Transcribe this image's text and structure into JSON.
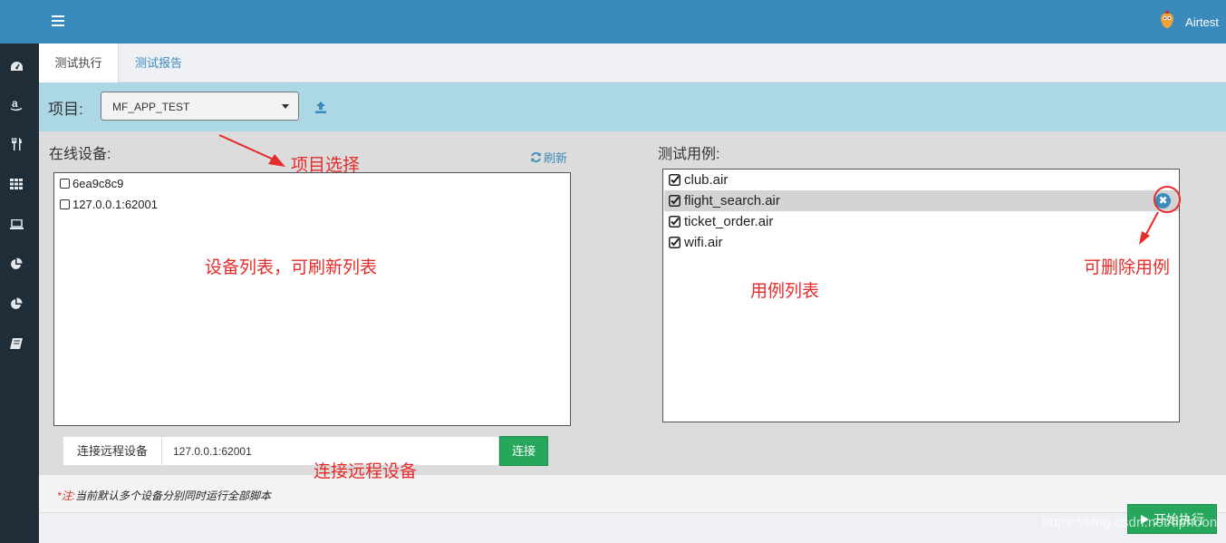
{
  "header": {
    "brand": "Airtest"
  },
  "sidebar": {
    "icons": [
      "dashboard-icon",
      "amazon-icon",
      "cutlery-icon",
      "grid-icon",
      "laptop-icon",
      "pie-chart-icon",
      "pie-chart-icon",
      "book-icon"
    ]
  },
  "tabs": [
    {
      "label": "测试执行"
    },
    {
      "label": "测试报告"
    }
  ],
  "project": {
    "label": "项目:",
    "selected": "MF_APP_TEST"
  },
  "devices": {
    "title": "在线设备:",
    "refresh_label": "刷新",
    "items": [
      {
        "name": "6ea9c8c9"
      },
      {
        "name": "127.0.0.1:62001"
      }
    ]
  },
  "cases": {
    "title": "测试用例:",
    "items": [
      {
        "name": "club.air"
      },
      {
        "name": "flight_search.air"
      },
      {
        "name": "ticket_order.air"
      },
      {
        "name": "wifi.air"
      }
    ]
  },
  "remote": {
    "addon": "连接远程设备",
    "value": "127.0.0.1:62001",
    "connect_label": "连接"
  },
  "footer": {
    "note_star": "*注:",
    "note_text": "当前默认多个设备分别同时运行全部脚本",
    "start_label": "开始执行"
  },
  "annotations": {
    "project_select": "项目选择",
    "device_list": "设备列表，可刷新列表",
    "case_list": "用例列表",
    "delete_case": "可删除用例",
    "remote_device": "连接远程设备"
  },
  "watermark": "https://blog.csdn.net/tiphoon",
  "colors": {
    "primary": "#3b8abe",
    "success": "#27a75c",
    "annotation": "#e62b2b",
    "project_bar": "#acd7e4",
    "sidebar": "#1f2d38"
  }
}
